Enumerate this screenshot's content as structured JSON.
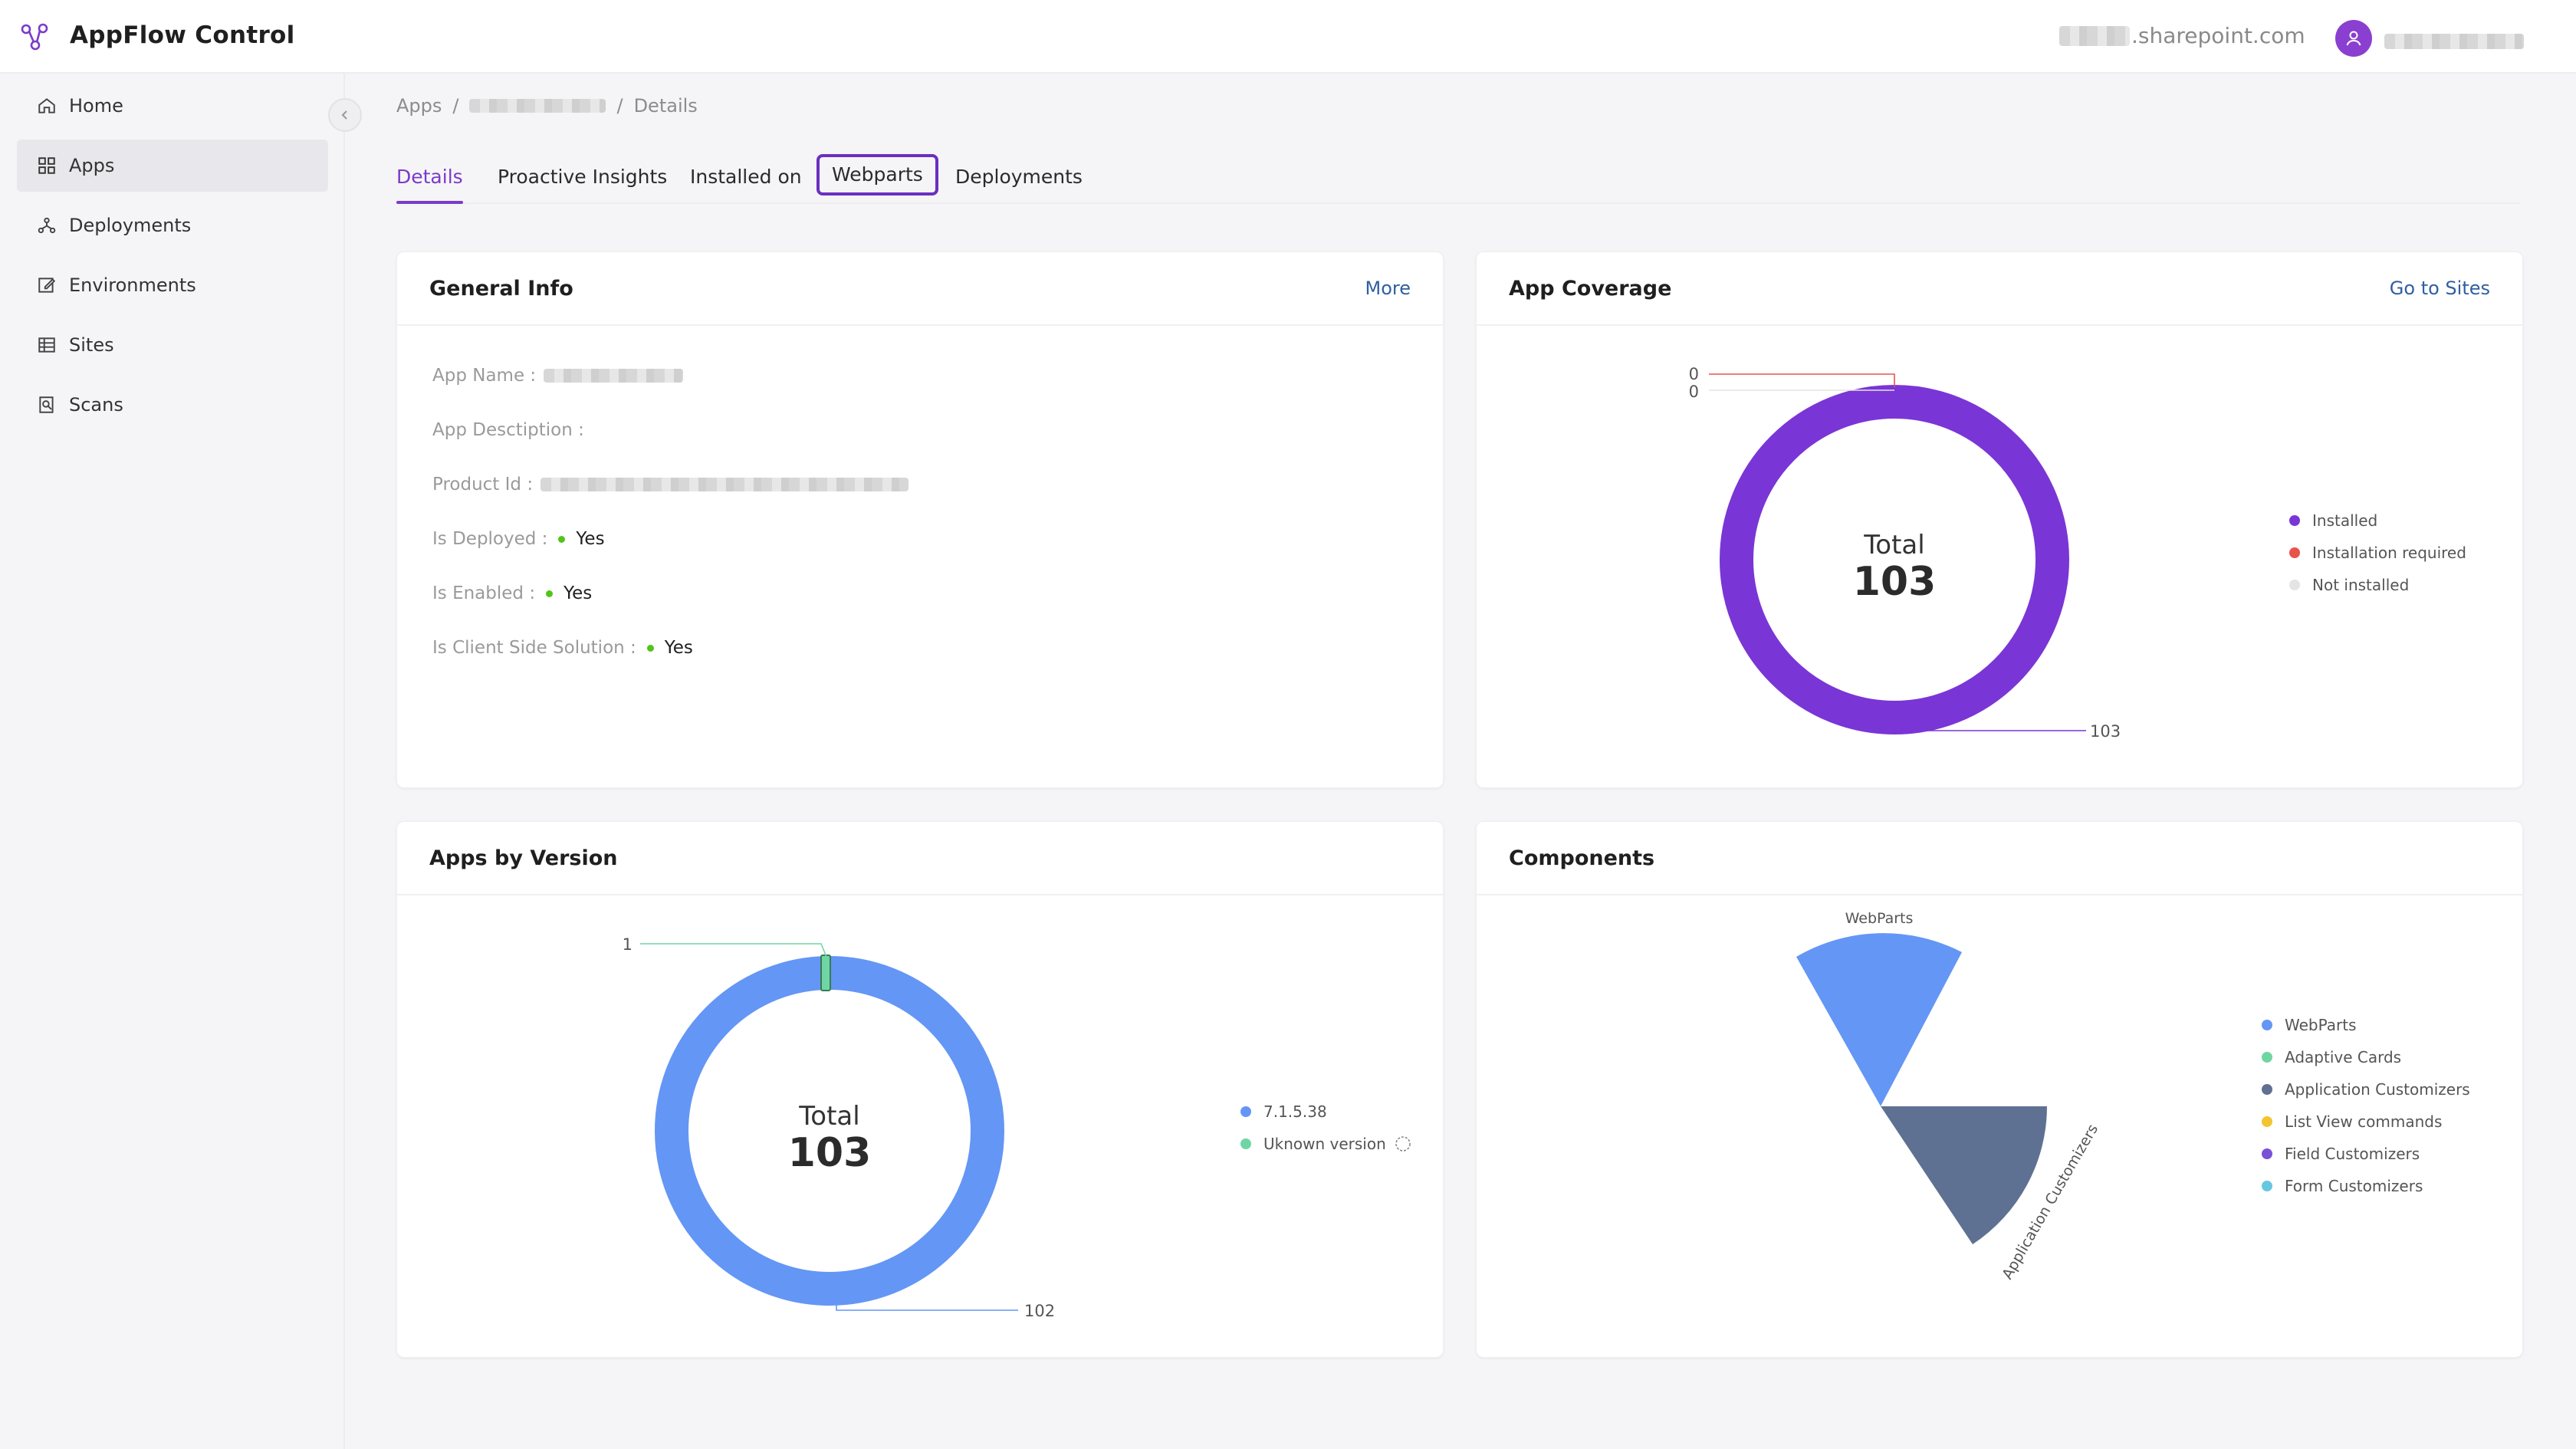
{
  "app": {
    "brand": "AppFlow Control",
    "tenant_suffix": ".sharepoint.com"
  },
  "sidebar": {
    "items": [
      {
        "label": "Home",
        "icon": "home-icon"
      },
      {
        "label": "Apps",
        "icon": "grid-icon",
        "active": true
      },
      {
        "label": "Deployments",
        "icon": "deployments-icon"
      },
      {
        "label": "Environments",
        "icon": "edit-icon"
      },
      {
        "label": "Sites",
        "icon": "table-icon"
      },
      {
        "label": "Scans",
        "icon": "scan-icon"
      }
    ]
  },
  "breadcrumb": {
    "root": "Apps",
    "sep": "/",
    "current": "Details"
  },
  "tabs": [
    {
      "label": "Details",
      "active": true
    },
    {
      "label": "Proactive Insights"
    },
    {
      "label": "Installed on"
    },
    {
      "label": "Webparts",
      "highlighted": true
    },
    {
      "label": "Deployments"
    }
  ],
  "general_info": {
    "title": "General Info",
    "more": "More",
    "fields": {
      "app_name": "App Name :",
      "app_description": "App Desctiption :",
      "product_id": "Product Id :",
      "is_deployed": "Is Deployed :",
      "is_enabled": "Is Enabled :",
      "is_client_side": "Is Client Side Solution :"
    },
    "values": {
      "deployed": "Yes",
      "enabled": "Yes",
      "client_side": "Yes"
    }
  },
  "coverage": {
    "title": "App Coverage",
    "link": "Go to Sites",
    "total_label": "Total",
    "total": "103",
    "labels": {
      "a": "0",
      "b": "0",
      "c": "103"
    },
    "legend": [
      "Installed",
      "Installation required",
      "Not installed"
    ],
    "colors": {
      "installed": "#7a35d6",
      "required": "#e8534c",
      "not_installed": "#e4e4e4"
    }
  },
  "versions": {
    "title": "Apps by Version",
    "total_label": "Total",
    "total": "103",
    "labels": {
      "small": "1",
      "large": "102"
    },
    "legend": [
      "7.1.5.38",
      "Uknown version"
    ],
    "colors": {
      "v1": "#6496f5",
      "unknown": "#6fd6a3"
    }
  },
  "components": {
    "title": "Components",
    "label_webparts": "WebParts",
    "label_app_customizers": "Application Customizers",
    "legend": [
      "WebParts",
      "Adaptive Cards",
      "Application Customizers",
      "List View commands",
      "Field Customizers",
      "Form Customizers"
    ],
    "colors": [
      "#6496f5",
      "#6fd6a3",
      "#5f7192",
      "#f4c430",
      "#7a52d6",
      "#67c7e0"
    ]
  },
  "chart_data": [
    {
      "type": "pie",
      "title": "App Coverage",
      "categories": [
        "Installed",
        "Installation required",
        "Not installed"
      ],
      "values": [
        103,
        0,
        0
      ]
    },
    {
      "type": "pie",
      "title": "Apps by Version",
      "categories": [
        "7.1.5.38",
        "Uknown version"
      ],
      "values": [
        102,
        1
      ]
    },
    {
      "type": "pie",
      "title": "Components",
      "categories": [
        "WebParts",
        "Adaptive Cards",
        "Application Customizers",
        "List View commands",
        "Field Customizers",
        "Form Customizers"
      ]
    }
  ]
}
